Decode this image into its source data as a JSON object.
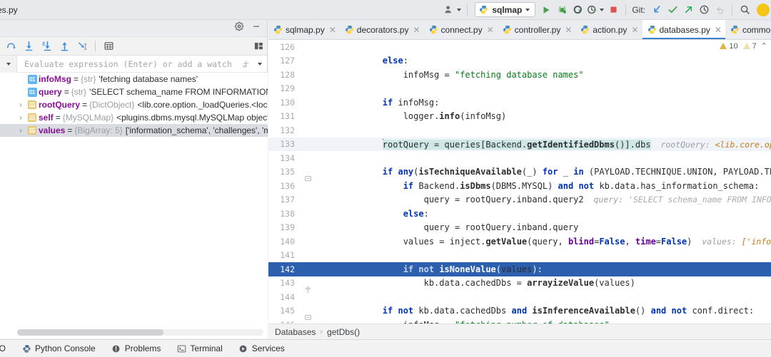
{
  "toolbar": {
    "left_title": "es.py",
    "user_icon": "users-icon",
    "run_config": {
      "label": "sqlmap",
      "icon": "python-icon",
      "dropdown": "chevron-down-icon"
    },
    "run_button": "run-icon",
    "debug_button": "debug-icon",
    "coverage_button": "run-with-coverage-icon",
    "profile_button": "profile-icon",
    "stop_button": "stop-icon",
    "git_label": "Git:",
    "git_update": "update-project-icon",
    "git_commit": "commit-icon",
    "git_push": "push-icon",
    "git_history": "history-icon",
    "git_rollback": "rollback-icon",
    "search_everywhere": "search-icon",
    "account": "account-avatar"
  },
  "debugger": {
    "settings_icon": "gear-icon",
    "minimize_icon": "minimize-icon",
    "toolbar_icons": [
      "step-over-icon",
      "step-into-icon",
      "force-step-into-icon",
      "step-out-icon",
      "run-to-cursor-icon",
      "evaluate-expression-icon"
    ],
    "layout_icon": "layout-settings-icon",
    "evaluate": {
      "placeholder": "Evaluate expression (Enter) or add a watch ...",
      "expand_icon": "chevron-down-icon",
      "add_watch_icon": "add-watch-icon",
      "options_icon": "chevron-down-icon"
    },
    "variables": [
      {
        "name": "infoMsg",
        "type": "{str}",
        "value": "'fetching database names'",
        "icon": "string-value-icon",
        "expandable": false,
        "selected": false
      },
      {
        "name": "query",
        "type": "{str}",
        "value": "'SELECT schema_name FROM INFORMATION_SCH",
        "icon": "string-value-icon",
        "expandable": false,
        "selected": false
      },
      {
        "name": "rootQuery",
        "type": "{DictObject}",
        "value": "<lib.core.option._loadQueries.<local",
        "icon": "object-value-icon",
        "expandable": true,
        "selected": false
      },
      {
        "name": "self",
        "type": "{MySQLMap}",
        "value": "<plugins.dbms.mysql.MySQLMap object ",
        "icon": "object-value-icon",
        "expandable": true,
        "selected": false
      },
      {
        "name": "values",
        "type": "{BigArray: 5}",
        "value": "['information_schema', 'challenges', 'my",
        "icon": "object-value-icon",
        "expandable": true,
        "selected": true
      }
    ]
  },
  "editor": {
    "tabs": [
      {
        "label": "sqlmap.py",
        "active": false,
        "close": "close-icon",
        "icon": "python-file-icon"
      },
      {
        "label": "decorators.py",
        "active": false,
        "close": "close-icon",
        "icon": "python-file-icon"
      },
      {
        "label": "connect.py",
        "active": false,
        "close": "close-icon",
        "icon": "python-file-icon"
      },
      {
        "label": "controller.py",
        "active": false,
        "close": "close-icon",
        "icon": "python-file-icon"
      },
      {
        "label": "action.py",
        "active": false,
        "close": "close-icon",
        "icon": "python-file-icon"
      },
      {
        "label": "databases.py",
        "active": true,
        "close": "close-icon",
        "icon": "python-file-icon"
      },
      {
        "label": "common.py",
        "active": false,
        "close": "close-icon",
        "icon": "python-file-icon"
      }
    ],
    "tabs_overflow_icon": "chevron-down-icon",
    "inspections": {
      "warnings_count": "10",
      "weak_warnings_count": "7",
      "chevron": "chevron-up-icon"
    },
    "breadcrumb": {
      "scope": "Databases",
      "member": "getDbs()",
      "separator": "›"
    },
    "first_line_number": 126,
    "lines": [
      {
        "n": "126",
        "text": ""
      },
      {
        "n": "127",
        "text": "        else:"
      },
      {
        "n": "128",
        "text": "            infoMsg = \"fetching database names\""
      },
      {
        "n": "129",
        "text": ""
      },
      {
        "n": "130",
        "text": "        if infoMsg:"
      },
      {
        "n": "131",
        "text": "            logger.info(infoMsg)"
      },
      {
        "n": "132",
        "text": ""
      },
      {
        "n": "133",
        "text": "        rootQuery = queries[Backend.getIdentifiedDbms()].dbs",
        "hint": "rootQuery: <lib.core.option._lo"
      },
      {
        "n": "134",
        "text": ""
      },
      {
        "n": "135",
        "text": "        if any(isTechniqueAvailable(_) for _ in (PAYLOAD.TECHNIQUE.UNION, PAYLOAD.TECHNIQUE.ER"
      },
      {
        "n": "136",
        "text": "            if Backend.isDbms(DBMS.MYSQL) and not kb.data.has_information_schema:"
      },
      {
        "n": "137",
        "text": "                query = rootQuery.inband.query2",
        "hint": "query: 'SELECT schema_name FROM INFORMATION_"
      },
      {
        "n": "138",
        "text": "            else:"
      },
      {
        "n": "139",
        "text": "                query = rootQuery.inband.query"
      },
      {
        "n": "140",
        "text": "            values = inject.getValue(query, blind=False, time=False)",
        "hint": "values: ['information_s"
      },
      {
        "n": "141",
        "text": ""
      },
      {
        "n": "142",
        "text": "            if not isNoneValue(values):",
        "executing": true
      },
      {
        "n": "143",
        "text": "                kb.data.cachedDbs = arrayizeValue(values)"
      },
      {
        "n": "144",
        "text": ""
      },
      {
        "n": "145",
        "text": "        if not kb.data.cachedDbs and isInferenceAvailable() and not conf.direct:"
      },
      {
        "n": "146",
        "text": "            infoMsg = \"fetching number of databases\""
      }
    ]
  },
  "statusbar": {
    "items": [
      {
        "label": "DO",
        "icon": "todo-icon"
      },
      {
        "label": "Python Console",
        "icon": "python-console-icon"
      },
      {
        "label": "Problems",
        "icon": "problems-icon"
      },
      {
        "label": "Terminal",
        "icon": "terminal-icon"
      },
      {
        "label": "Services",
        "icon": "services-icon"
      }
    ]
  },
  "colors": {
    "accent_blue": "#3a7fd0",
    "exec_line": "#2d5faf",
    "selection": "#cfe8e6",
    "string_green": "#067d17",
    "keyword_blue": "#0033b3",
    "variable_purple": "#871094",
    "warning_yellow": "#e3b341",
    "run_green": "#499c54",
    "stop_red": "#e05252"
  }
}
